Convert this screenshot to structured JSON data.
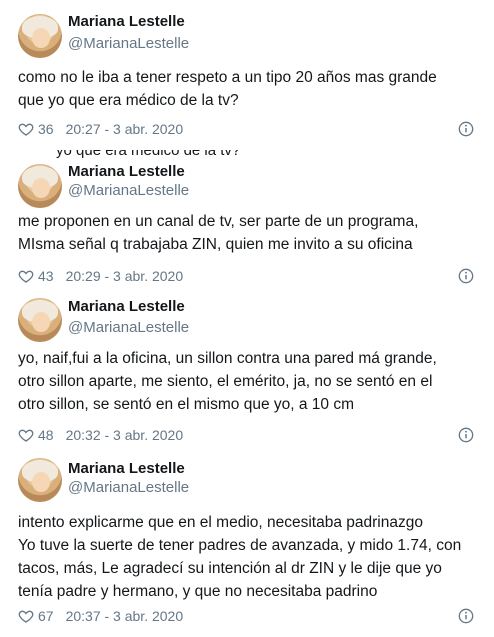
{
  "colors": {
    "text": "#14171a",
    "secondary": "#657786",
    "divider": "#ccd6dd"
  },
  "icons": {
    "like": "heart-icon",
    "info": "info-icon"
  },
  "tweets": [
    {
      "name": "Mariana Lestelle",
      "handle": "@MarianaLestelle",
      "lines": [
        "como no le iba a tener respeto a un tipo 20 años mas grande",
        "que yo que era médico de la tv?"
      ],
      "likes": "36",
      "time": "20:27 - 3 abr. 2020"
    },
    {
      "bleed": "yo que era médico de la tv?",
      "name": "Mariana Lestelle",
      "handle": "@MarianaLestelle",
      "lines": [
        "me proponen en un canal de tv, ser parte de un programa,",
        "MIsma señal q trabajaba ZIN, quien me invito a su oficina"
      ],
      "likes": "43",
      "time": "20:29 - 3 abr. 2020"
    },
    {
      "name": "Mariana Lestelle",
      "handle": "@MarianaLestelle",
      "lines": [
        "yo, naif,fui a la oficina, un sillon contra una pared má grande,",
        "otro sillon aparte, me siento, el emérito, ja, no se sentó en el",
        "otro sillon, se sentó en el mismo que yo, a 10 cm"
      ],
      "likes": "48",
      "time": "20:32 - 3 abr. 2020"
    },
    {
      "name": "Mariana Lestelle",
      "handle": "@MarianaLestelle",
      "lines": [
        "intento explicarme que en el medio, necesitaba padrinazgo",
        "Yo tuve la suerte de tener padres de avanzada, y mido 1.74, con",
        "tacos, más, Le agradecí su intención al dr ZIN y le dije que yo",
        "tenía padre y hermano, y que no necesitaba padrino"
      ],
      "likes": "67",
      "time": "20:37 - 3 abr. 2020"
    }
  ]
}
